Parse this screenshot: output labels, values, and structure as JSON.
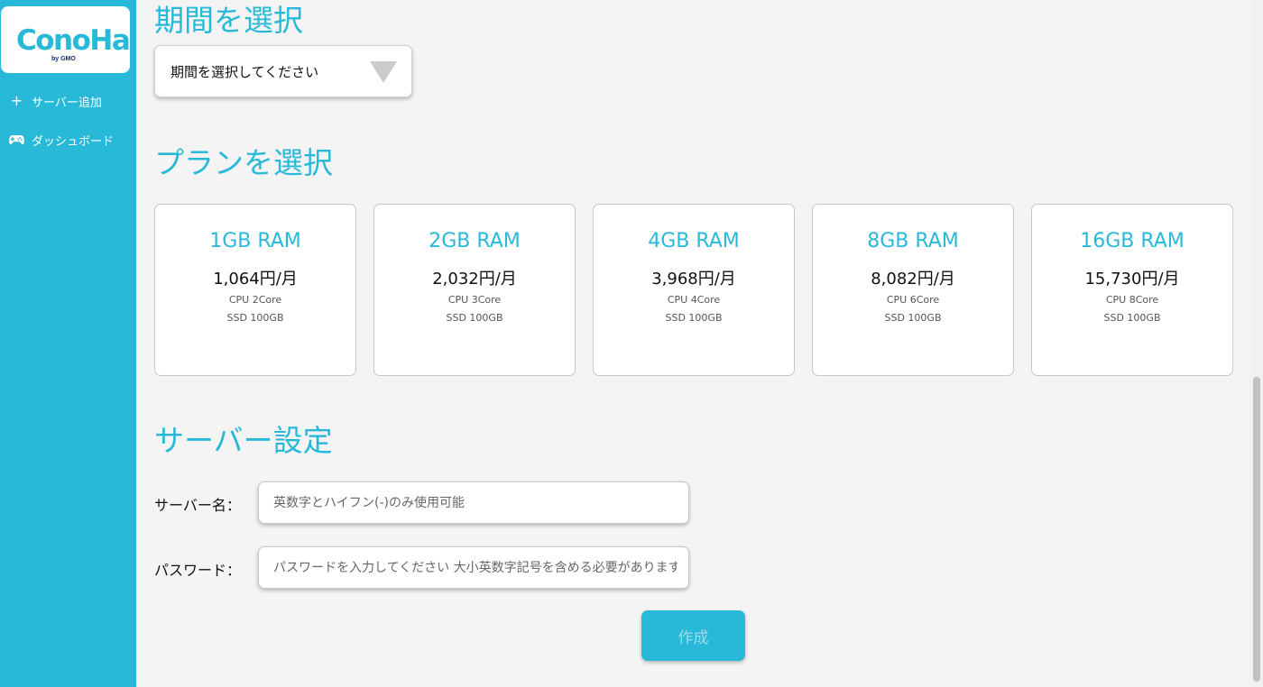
{
  "brand": {
    "logo_text": "ConoHa",
    "logo_sub": "by GMO"
  },
  "sidebar": {
    "items": [
      {
        "label": "サーバー追加",
        "icon": "plus-icon"
      },
      {
        "label": "ダッシュボード",
        "icon": "gamepad-icon"
      }
    ]
  },
  "period": {
    "title": "期間を選択",
    "select_placeholder": "期間を選択してください"
  },
  "plan": {
    "title": "プランを選択",
    "cards": [
      {
        "ram": "1GB RAM",
        "price": "1,064円/月",
        "cpu": "CPU 2Core",
        "ssd": "SSD 100GB"
      },
      {
        "ram": "2GB RAM",
        "price": "2,032円/月",
        "cpu": "CPU 3Core",
        "ssd": "SSD 100GB"
      },
      {
        "ram": "4GB RAM",
        "price": "3,968円/月",
        "cpu": "CPU 4Core",
        "ssd": "SSD 100GB"
      },
      {
        "ram": "8GB RAM",
        "price": "8,082円/月",
        "cpu": "CPU 6Core",
        "ssd": "SSD 100GB"
      },
      {
        "ram": "16GB RAM",
        "price": "15,730円/月",
        "cpu": "CPU 8Core",
        "ssd": "SSD 100GB"
      }
    ]
  },
  "server": {
    "title": "サーバー設定",
    "name_label": "サーバー名：",
    "name_placeholder": "英数字とハイフン(-)のみ使用可能",
    "password_label": "パスワード：",
    "password_placeholder": "パスワードを入力してください 大小英数字記号を含める必要があります",
    "create_label": "作成"
  },
  "colors": {
    "accent": "#29b9d8",
    "background": "#f4f4f4"
  }
}
